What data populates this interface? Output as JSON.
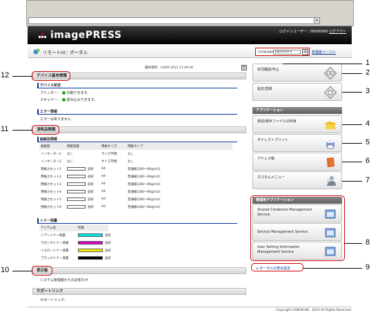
{
  "header": {
    "logo_text": "imagePRESS",
    "login_text": "ログインユーザー：00000000",
    "logout_label": "ログアウト"
  },
  "subheader": {
    "title": "リモートUI：ポータル",
    "language_label": "Language:",
    "language_value": "Japanese",
    "admin_link": "管理者ページへ"
  },
  "updated": "最終更新：14/06 2013 11:49:40",
  "device_info": {
    "section_title": "デバイス基本情報",
    "status_title": "デバイス状況",
    "printer_label": "プリンター：",
    "printer_status": "印刷できます。",
    "scanner_label": "スキャナー：",
    "scanner_status": "読み込みできます。",
    "error_title": "エラー情報",
    "error_text": "エラーはありません"
  },
  "consumables": {
    "section_title": "消耗品情報",
    "paper_title": "給紙段情報",
    "paper_headers": [
      "給紙部",
      "用紙残量",
      "用紙サイズ",
      "用紙タイプ"
    ],
    "paper_rows": [
      {
        "source": "インサーター1",
        "level": "なし",
        "size": "サイズ不明",
        "type": "なし"
      },
      {
        "source": "インサーター2",
        "level": "なし",
        "size": "サイズ不明",
        "type": "なし"
      },
      {
        "source": "用紙カセット1",
        "level": "良好",
        "size": "A4",
        "type": "普通紙1(80～90g/m2)"
      },
      {
        "source": "用紙カセット2",
        "level": "良好",
        "size": "A4",
        "type": "普通紙1(80～90g/m2)"
      },
      {
        "source": "用紙カセット3",
        "level": "良好",
        "size": "A4",
        "type": "普通紙1(80～90g/m2)"
      },
      {
        "source": "用紙カセット4",
        "level": "良好",
        "size": "A4",
        "type": "普通紙1(80～90g/m2)"
      },
      {
        "source": "用紙カセット5",
        "level": "良好",
        "size": "A4",
        "type": "普通紙1(80～90g/m2)"
      },
      {
        "source": "用紙カセット6",
        "level": "良好",
        "size": "A4",
        "type": "普通紙1(80～90g/m2)"
      }
    ],
    "toner_title": "トナー残量",
    "toner_headers": [
      "アイテム名",
      "残量"
    ],
    "toner_rows": [
      {
        "name": "シアントナー残量",
        "status": "良好",
        "color": "#00e5e5"
      },
      {
        "name": "マゼンタトナー残量",
        "status": "良好",
        "color": "#e000c8"
      },
      {
        "name": "イエロートナー残量",
        "status": "良好",
        "color": "#f5f000"
      },
      {
        "name": "ブラックトナー残量",
        "status": "良好",
        "color": "#000000"
      }
    ]
  },
  "messages": {
    "section_title": "表示板",
    "text": "システム管理者からのお知らせ"
  },
  "support": {
    "section_title": "サポートリンク",
    "text": "サポートリンク："
  },
  "right": {
    "status_button": "状況確認/中止",
    "settings_button": "設定/登録",
    "apps_title": "アプリケーション",
    "apps": [
      "受信/保存ファイルの利用",
      "ダイレクトプリント",
      "アドレス帳",
      "カスタムメニュー"
    ],
    "admin_apps_title": "管理用アプリケーション",
    "admin_apps": [
      "Shared Credential Management Service",
      "Service Management Service",
      "User Setting Information Management Service"
    ],
    "portal_link": "ポータルの表示設定"
  },
  "footer": {
    "copyright": "Copyright CANON INC. 2013 All Rights Reserved."
  },
  "callouts": [
    "1",
    "2",
    "3",
    "4",
    "5",
    "6",
    "7",
    "8",
    "9",
    "10",
    "11",
    "12"
  ]
}
